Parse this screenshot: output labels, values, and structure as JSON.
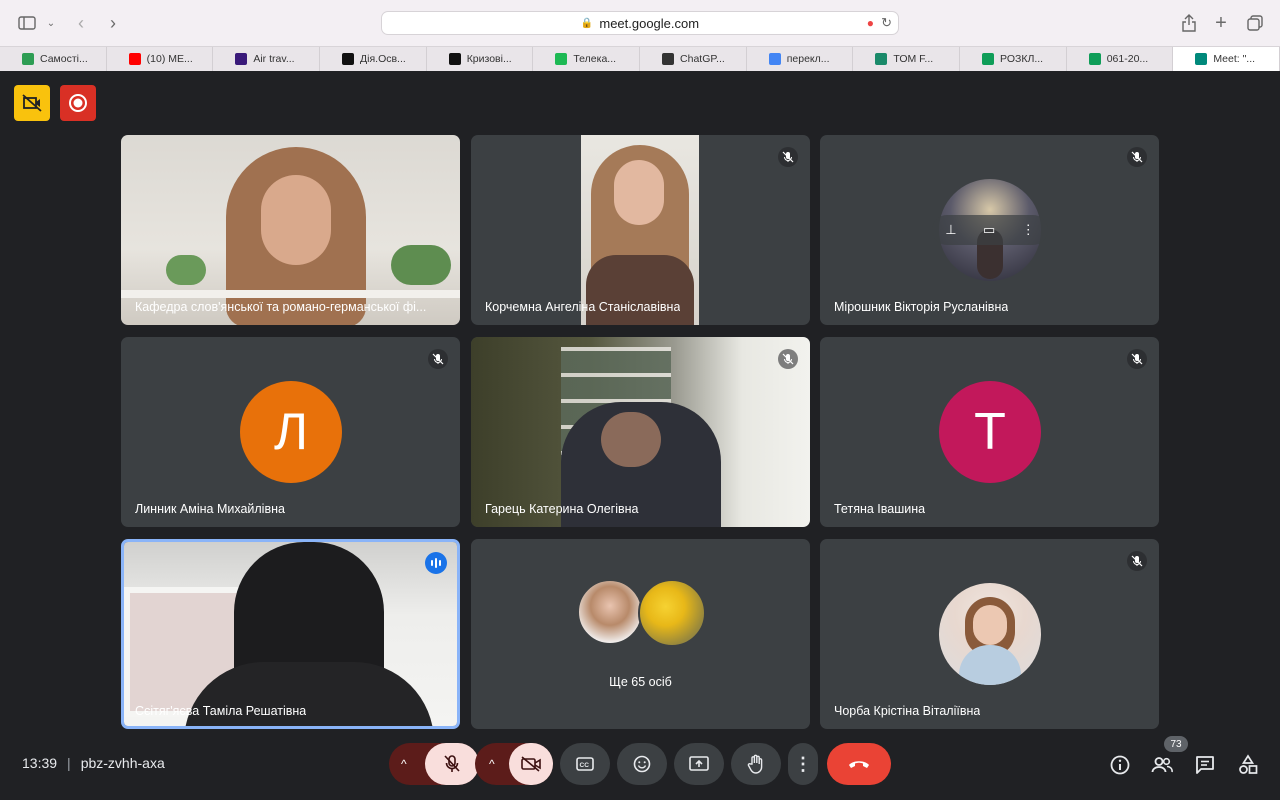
{
  "browser": {
    "url": "meet.google.com",
    "tabs": [
      {
        "label": "Самості...",
        "color": "#2e9d54"
      },
      {
        "label": "(10) ME...",
        "color": "#ff0000"
      },
      {
        "label": "Air trav...",
        "color": "#3a1a7a"
      },
      {
        "label": "Дія.Осв...",
        "color": "#111111"
      },
      {
        "label": "Кризові...",
        "color": "#111111"
      },
      {
        "label": "Телека...",
        "color": "#1db954"
      },
      {
        "label": "ChatGP...",
        "color": "#333333"
      },
      {
        "label": "перекл...",
        "color": "#4285f4"
      },
      {
        "label": "ТОМ F...",
        "color": "#1a8a6a"
      },
      {
        "label": "РОЗКЛ...",
        "color": "#0f9d58"
      },
      {
        "label": "061-20...",
        "color": "#0f9d58"
      },
      {
        "label": "Meet: \"...",
        "color": "#00897b"
      }
    ]
  },
  "participants": [
    {
      "name": "Кафедра слов'янської та романо-германської фі...",
      "muted": false,
      "type": "video"
    },
    {
      "name": "Корчемна Ангеліна Станіславівна",
      "muted": true,
      "type": "video"
    },
    {
      "name": "Мірошник Вікторія Русланівна",
      "muted": true,
      "type": "photo"
    },
    {
      "name": "Линник Аміна Михайлівна",
      "muted": true,
      "type": "letter",
      "letter": "Л",
      "color": "#e8710a"
    },
    {
      "name": "Гарець Катерина Олегівна",
      "muted": true,
      "type": "video"
    },
    {
      "name": "Тетяна Івашина",
      "muted": true,
      "type": "letter",
      "letter": "Т",
      "color": "#c2185b"
    },
    {
      "name": "Сєітяг'яєва Таміла Решатівна",
      "muted": false,
      "type": "video",
      "speaking": true
    },
    {
      "name": "Ще 65 осіб",
      "type": "more"
    },
    {
      "name": "Чорба Крістіна Віталіївна",
      "muted": true,
      "type": "photo"
    }
  ],
  "meeting": {
    "time": "13:39",
    "code": "pbz-zvhh-axa",
    "participant_count": "73"
  },
  "colors": {
    "background": "#202124",
    "tile": "#3c4043",
    "end_call": "#ea4335",
    "mic_off": "#f9dedc",
    "accent": "#8ab4f8"
  }
}
